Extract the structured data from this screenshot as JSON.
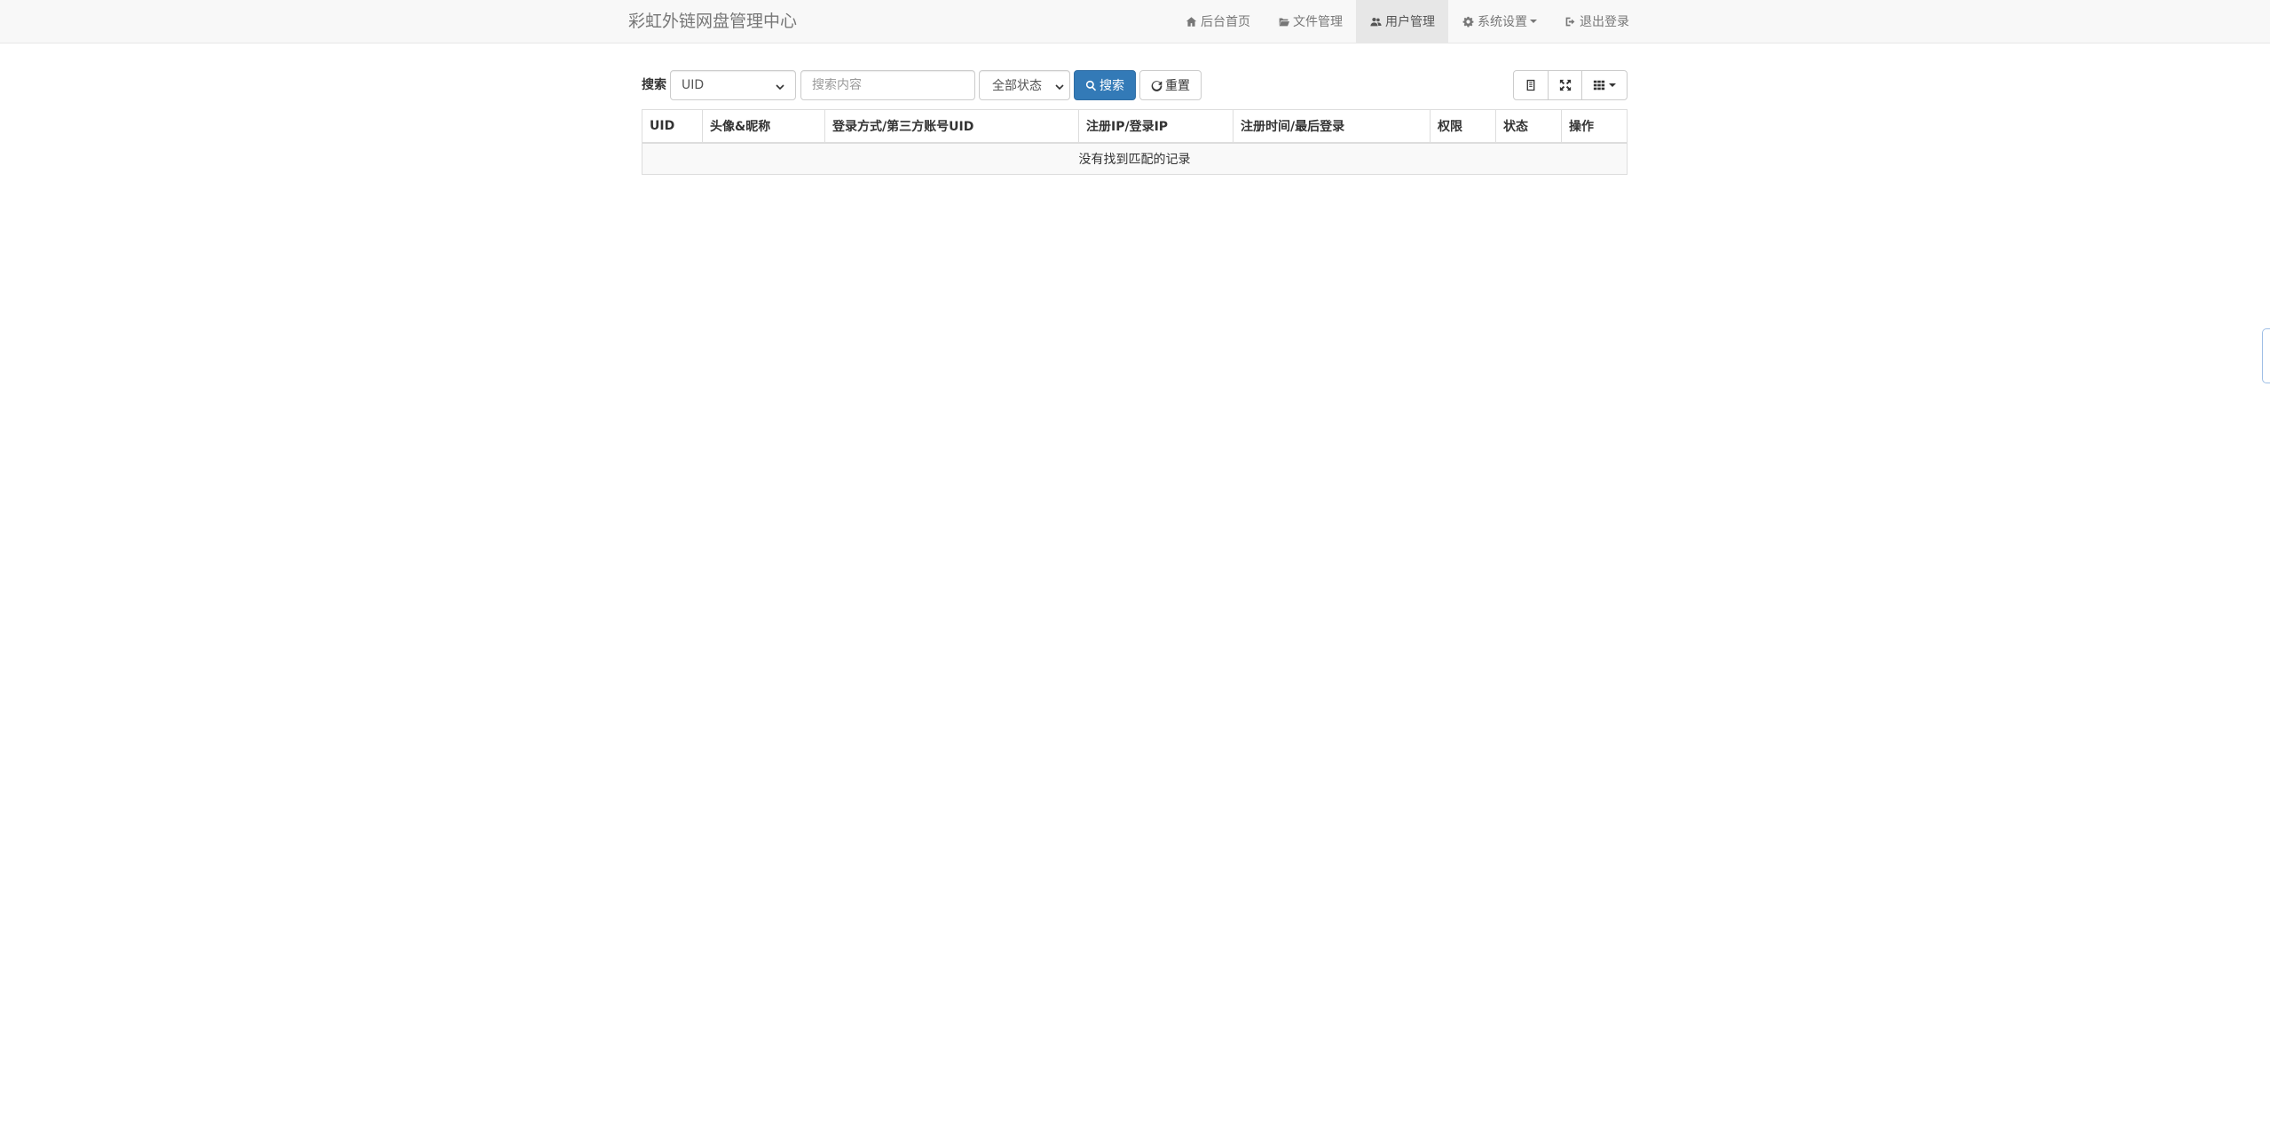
{
  "navbar": {
    "brand": "彩虹外链网盘管理中心",
    "items": [
      {
        "label": "后台首页",
        "icon": "home-icon",
        "active": false
      },
      {
        "label": "文件管理",
        "icon": "folder-open-icon",
        "active": false
      },
      {
        "label": "用户管理",
        "icon": "users-icon",
        "active": true
      },
      {
        "label": "系统设置",
        "icon": "gear-icon",
        "active": false,
        "dropdown": true
      },
      {
        "label": "退出登录",
        "icon": "sign-out-icon",
        "active": false
      }
    ]
  },
  "toolbar": {
    "search_label": "搜索",
    "type_select_value": "UID",
    "search_placeholder": "搜索内容",
    "status_select_value": "全部状态",
    "search_button": "搜索",
    "reset_button": "重置",
    "right_buttons": [
      "list-view-icon",
      "fullscreen-icon",
      "columns-grid-icon"
    ]
  },
  "table": {
    "columns": [
      "UID",
      "头像&昵称",
      "登录方式/第三方账号UID",
      "注册IP/登录IP",
      "注册时间/最后登录",
      "权限",
      "状态",
      "操作"
    ],
    "empty_message": "没有找到匹配的记录"
  },
  "colors": {
    "primary": "#337ab7",
    "navbar_bg": "#f8f8f8",
    "nav_active_bg": "#e7e7e7",
    "border": "#dddddd"
  }
}
